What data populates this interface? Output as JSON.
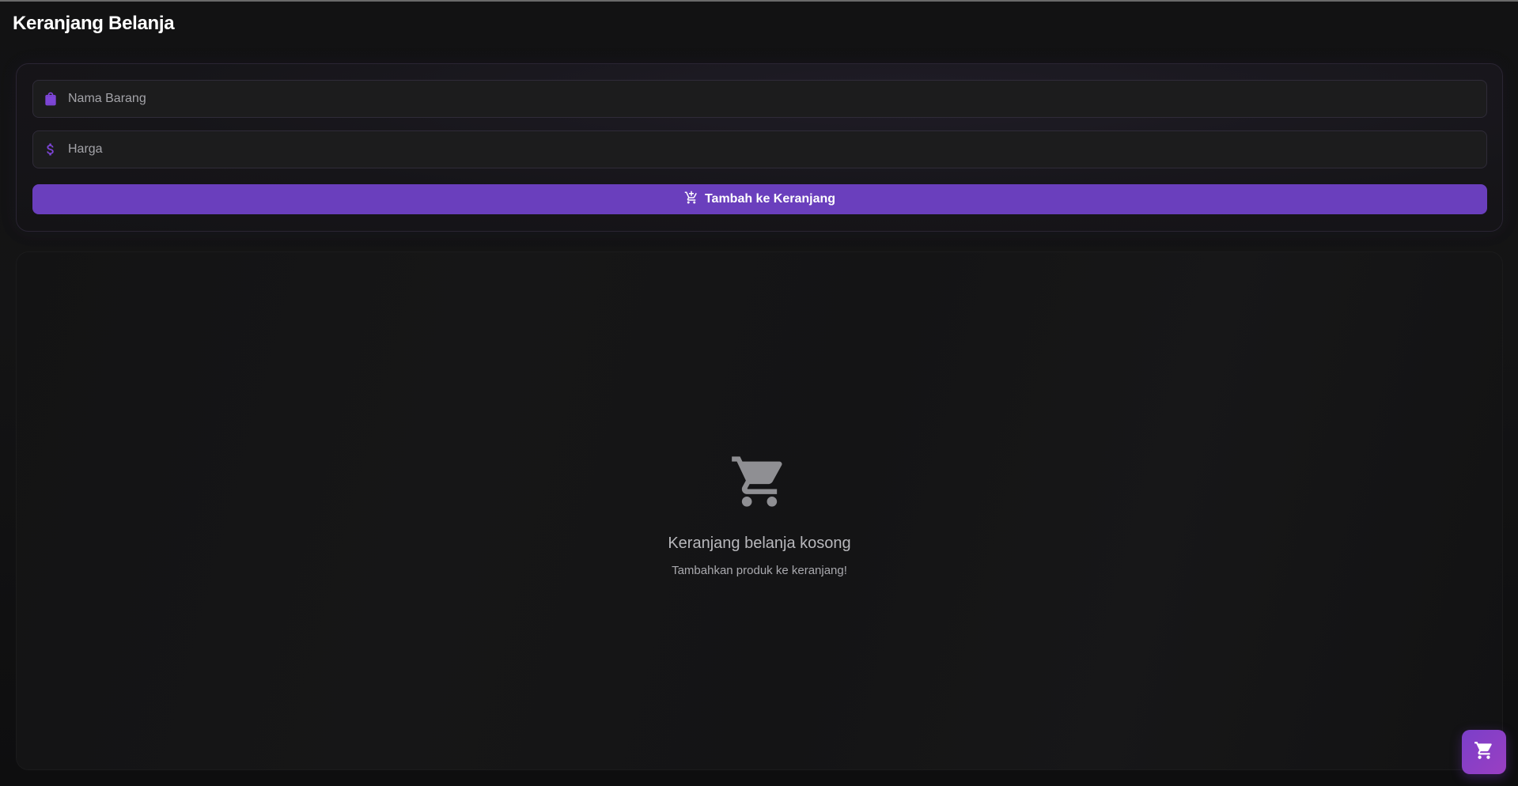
{
  "header": {
    "title": "Keranjang Belanja"
  },
  "form": {
    "name_field": {
      "placeholder": "Nama Barang",
      "value": "",
      "icon": "shopping-bag-icon"
    },
    "price_field": {
      "placeholder": "Harga",
      "value": "",
      "icon": "dollar-icon"
    },
    "add_button": {
      "label": "Tambah ke Keranjang",
      "icon": "add-cart-icon"
    }
  },
  "cart": {
    "empty_icon": "shopping-cart-icon",
    "empty_title": "Keranjang belanja kosong",
    "empty_subtitle": "Tambahkan produk ke keranjang!"
  },
  "fab": {
    "icon": "shopping-cart-icon"
  },
  "colors": {
    "accent": "#6a3fbd",
    "icon_accent": "#7d45d6",
    "fab_gradient_start": "#7b3fc9",
    "fab_gradient_end": "#9a3fc2",
    "background": "#121213"
  }
}
